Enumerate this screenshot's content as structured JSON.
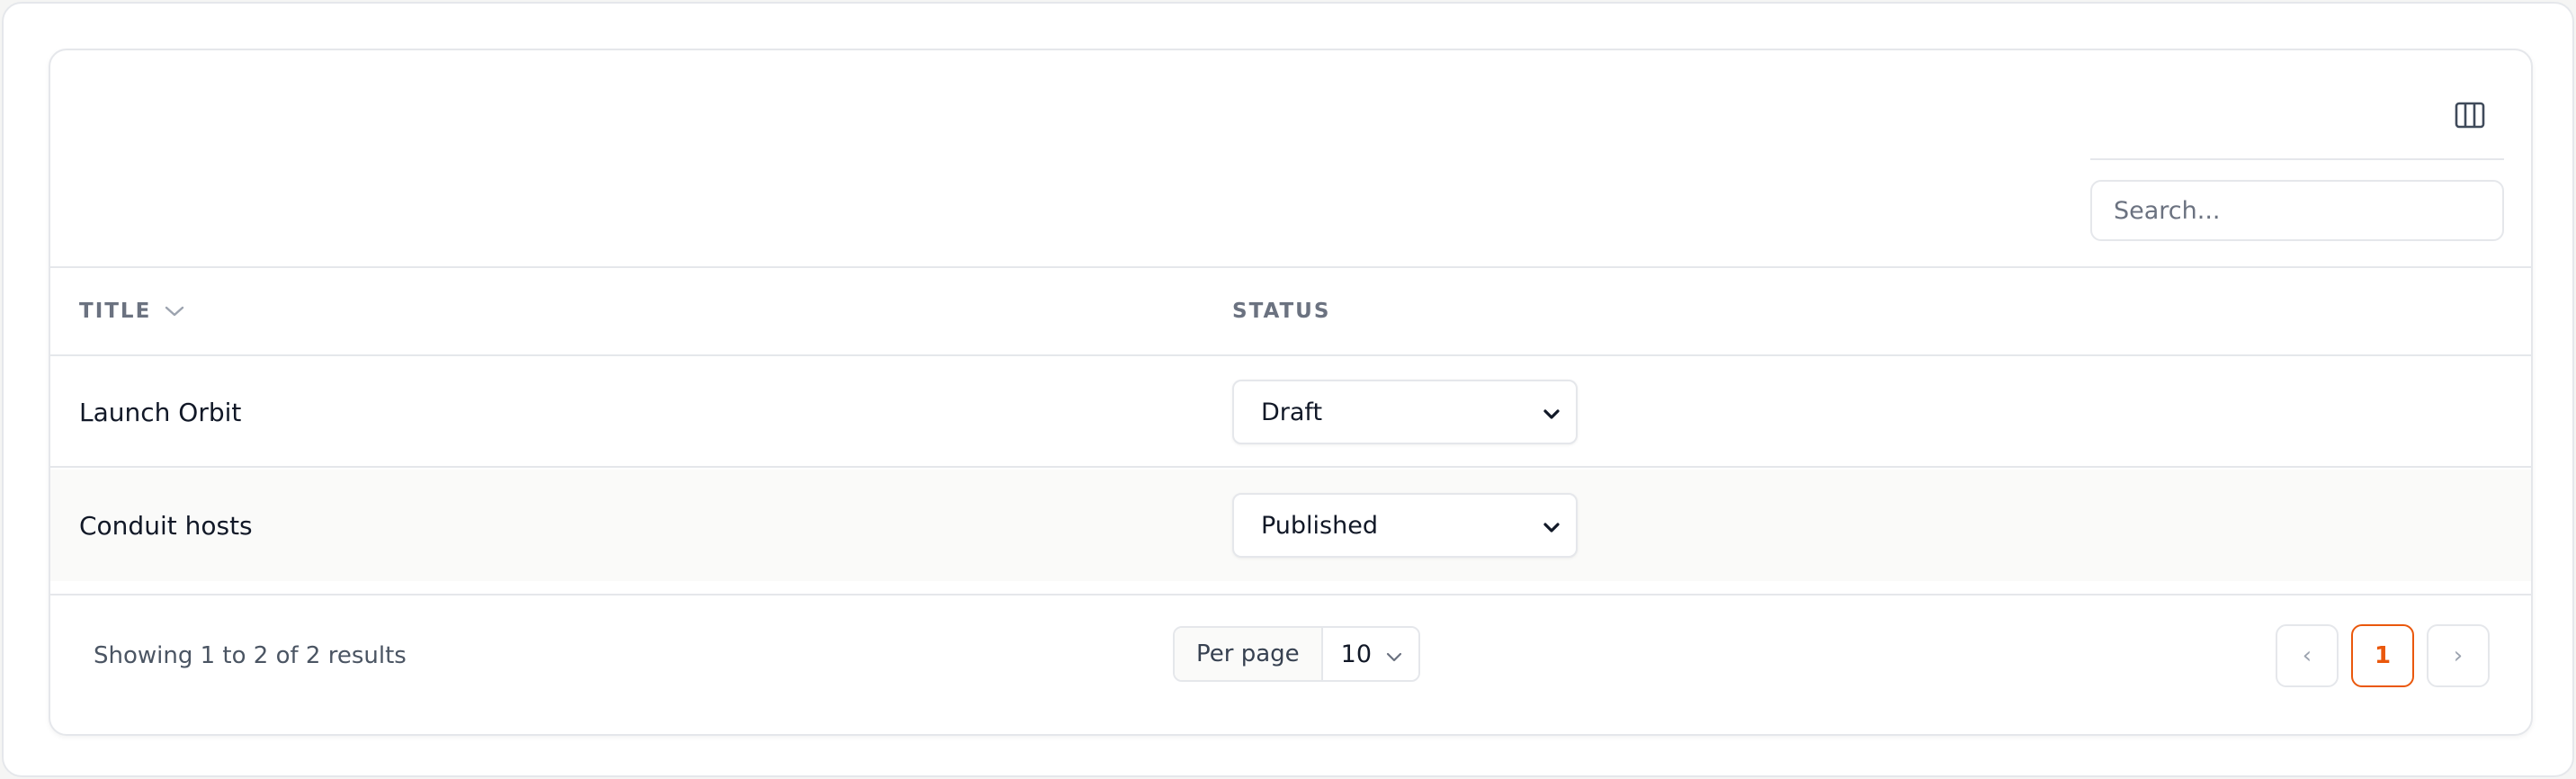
{
  "toolbar": {
    "columns_icon": "columns-icon",
    "search_placeholder": "Search..."
  },
  "table": {
    "columns": [
      {
        "label": "Title",
        "sortable": true,
        "sort_icon": "chevron-down-icon"
      },
      {
        "label": "Status",
        "sortable": false
      }
    ],
    "rows": [
      {
        "title": "Launch Orbit",
        "status": "Draft"
      },
      {
        "title": "Conduit hosts",
        "status": "Published"
      }
    ]
  },
  "footer": {
    "results_text": "Showing 1 to 2 of 2 results",
    "per_page_label": "Per page",
    "per_page_value": "10",
    "pagination": {
      "prev": "‹",
      "current_page": "1",
      "next": "›"
    }
  },
  "colors": {
    "accent": "#ea580c",
    "border": "#e5e7eb",
    "muted_text": "#6b7280",
    "row_alt_bg": "#fafaf9"
  }
}
